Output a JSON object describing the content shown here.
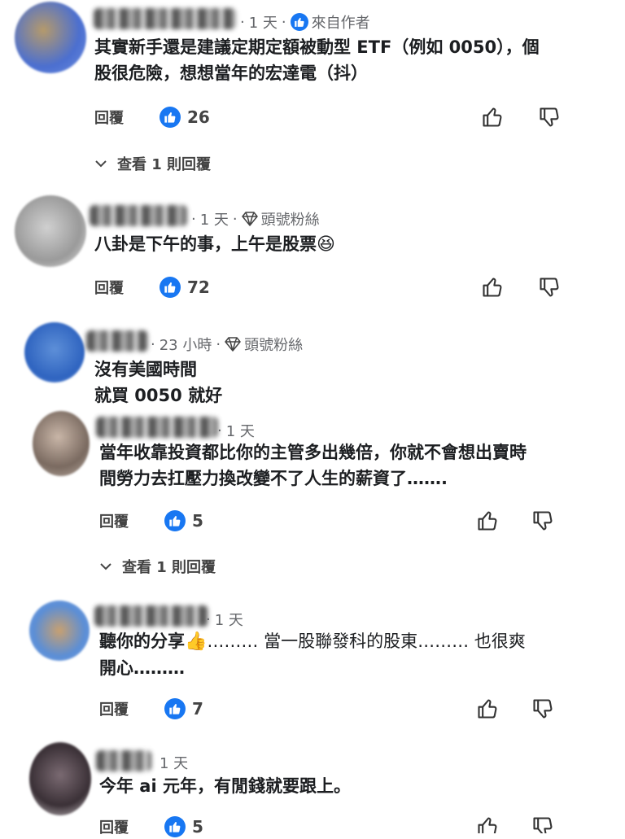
{
  "colors": {
    "accent": "#1877f2",
    "text": "#1c1e21",
    "meta": "#65676b"
  },
  "reply_label": "回覆",
  "comments": [
    {
      "meta_time": "1 天",
      "badge_text": "來自作者",
      "lines": [
        "其實新手還是建議定期定額被動型 ETF（例如 0050），個",
        "股很危險，想想當年的宏達電（抖）"
      ],
      "likes": "26",
      "view_replies": "查看 1 則回覆"
    },
    {
      "meta_time": "1 天",
      "badge_text": "頭號粉絲",
      "lines": [
        "八卦是下午的事，上午是股票"
      ],
      "emoji": "😆",
      "likes": "72"
    },
    {
      "meta_time": "23 小時",
      "badge_text": "頭號粉絲",
      "lines": [
        "沒有美國時間",
        "就買 0050 就好"
      ]
    },
    {
      "meta_time": "1 天",
      "lines": [
        "當年收靠投資都比你的主管多出幾倍，你就不會想出賣時",
        "間勞力去扛壓力換改變不了人生的薪資了……."
      ],
      "likes": "5",
      "view_replies": "查看 1 則回覆"
    },
    {
      "meta_time": "1 天",
      "lines": [
        "聽你的分享",
        "………  當一股聯發科的股東………  也很爽",
        "開心………"
      ],
      "emoji": "👍",
      "likes": "7"
    },
    {
      "meta_time": "1 天",
      "lines": [
        "今年 ai 元年，有閒錢就要跟上。"
      ],
      "likes": "5"
    }
  ]
}
